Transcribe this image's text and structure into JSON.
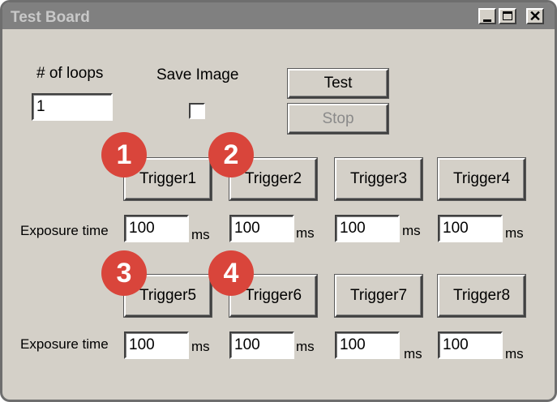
{
  "window": {
    "title": "Test Board",
    "minimize_label": "_",
    "maximize_label": "□",
    "close_label": "✕"
  },
  "controls": {
    "loops_label": "# of loops",
    "loops_value": "1",
    "save_image_label": "Save Image",
    "save_image_checked": false,
    "test_button": "Test",
    "stop_button": "Stop"
  },
  "triggers": [
    {
      "label": "Trigger1",
      "exposure": "100",
      "unit": "ms",
      "badge": "1"
    },
    {
      "label": "Trigger2",
      "exposure": "100",
      "unit": "ms",
      "badge": "2"
    },
    {
      "label": "Trigger3",
      "exposure": "100",
      "unit": "ms",
      "badge": ""
    },
    {
      "label": "Trigger4",
      "exposure": "100",
      "unit": "ms",
      "badge": ""
    },
    {
      "label": "Trigger5",
      "exposure": "100",
      "unit": "ms",
      "badge": "3"
    },
    {
      "label": "Trigger6",
      "exposure": "100",
      "unit": "ms",
      "badge": "4"
    },
    {
      "label": "Trigger7",
      "exposure": "100",
      "unit": "ms",
      "badge": ""
    },
    {
      "label": "Trigger8",
      "exposure": "100",
      "unit": "ms",
      "badge": ""
    }
  ],
  "exposure_label": "Exposure time",
  "colors": {
    "window_bg": "#d4d0c8",
    "titlebar": "#808080",
    "badge": "#d9453b"
  }
}
